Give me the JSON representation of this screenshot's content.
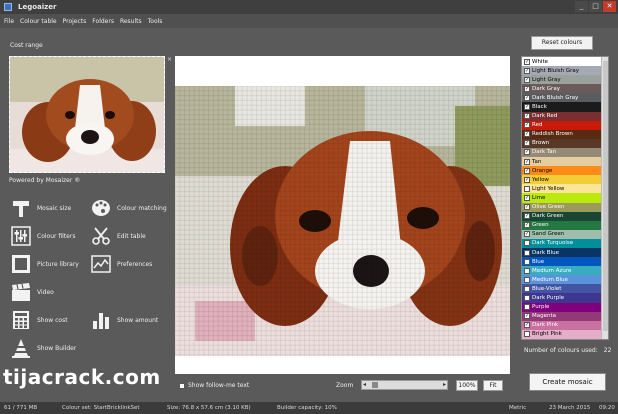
{
  "window": {
    "title": "Legoaizer",
    "controls": [
      "_",
      "□",
      "✕"
    ]
  },
  "menu": [
    "File",
    "Colour table",
    "Projects",
    "Folders",
    "Results",
    "Tools"
  ],
  "left_panel": {
    "cost_range": "Cost range",
    "close_glyph": "×",
    "powered_by": "Powered by Mosaizer ®",
    "tools": [
      {
        "label": "Mosaic size",
        "icon": "hammer-icon"
      },
      {
        "label": "Colour matching",
        "icon": "palette-icon"
      },
      {
        "label": "Colour filters",
        "icon": "sliders-icon"
      },
      {
        "label": "Edit table",
        "icon": "scissors-icon"
      },
      {
        "label": "Picture library",
        "icon": "film-frame-icon"
      },
      {
        "label": "Preferences",
        "icon": "chart-window-icon"
      },
      {
        "label": "Video",
        "icon": "clapperboard-icon"
      },
      {
        "label": "Show cost",
        "icon": "calculator-icon"
      },
      {
        "label": "Show amount",
        "icon": "bar-chart-icon"
      },
      {
        "label": "Show Builder",
        "icon": "cone-icon"
      }
    ]
  },
  "right_panel": {
    "reset_button": "Reset colours",
    "colours": [
      {
        "name": "White",
        "hex": "#ffffff",
        "checked": true,
        "text": "#000000"
      },
      {
        "name": "Light Bluish Gray",
        "hex": "#a5a9b4",
        "checked": true,
        "text": "#000000"
      },
      {
        "name": "Light Gray",
        "hex": "#9ba19d",
        "checked": true,
        "text": "#000000"
      },
      {
        "name": "Dark Gray",
        "hex": "#6b5a5a",
        "checked": true,
        "text": "#ffffff"
      },
      {
        "name": "Dark Bluish Gray",
        "hex": "#595d60",
        "checked": true,
        "text": "#ffffff"
      },
      {
        "name": "Black",
        "hex": "#1b1b1b",
        "checked": true,
        "text": "#ffffff"
      },
      {
        "name": "Dark Red",
        "hex": "#7b2e2f",
        "checked": true,
        "text": "#ffffff"
      },
      {
        "name": "Red",
        "hex": "#c91a09",
        "checked": true,
        "text": "#ffffff"
      },
      {
        "name": "Reddish Brown",
        "hex": "#582a12",
        "checked": true,
        "text": "#ffffff"
      },
      {
        "name": "Brown",
        "hex": "#583927",
        "checked": true,
        "text": "#ffffff"
      },
      {
        "name": "Dark Tan",
        "hex": "#958a73",
        "checked": true,
        "text": "#ffffff"
      },
      {
        "name": "Tan",
        "hex": "#e4cd9e",
        "checked": true,
        "text": "#000000"
      },
      {
        "name": "Orange",
        "hex": "#fe8a18",
        "checked": true,
        "text": "#000000"
      },
      {
        "name": "Yellow",
        "hex": "#f2cd37",
        "checked": true,
        "text": "#000000"
      },
      {
        "name": "Light Yellow",
        "hex": "#fbe696",
        "checked": false,
        "text": "#000000"
      },
      {
        "name": "Lime",
        "hex": "#bbe90b",
        "checked": true,
        "text": "#000000"
      },
      {
        "name": "Olive Green",
        "hex": "#9b9a5a",
        "checked": true,
        "text": "#ffffff"
      },
      {
        "name": "Dark Green",
        "hex": "#184632",
        "checked": true,
        "text": "#ffffff"
      },
      {
        "name": "Green",
        "hex": "#237841",
        "checked": true,
        "text": "#ffffff"
      },
      {
        "name": "Sand Green",
        "hex": "#a0bcac",
        "checked": true,
        "text": "#000000"
      },
      {
        "name": "Dark Turquoise",
        "hex": "#008f9b",
        "checked": false,
        "text": "#ffffff"
      },
      {
        "name": "Dark Blue",
        "hex": "#0a3463",
        "checked": false,
        "text": "#ffffff"
      },
      {
        "name": "Blue",
        "hex": "#0055bf",
        "checked": false,
        "text": "#ffffff"
      },
      {
        "name": "Medium Azure",
        "hex": "#36aebf",
        "checked": false,
        "text": "#ffffff"
      },
      {
        "name": "Medium Blue",
        "hex": "#5a93db",
        "checked": false,
        "text": "#ffffff"
      },
      {
        "name": "Blue-Violet",
        "hex": "#4354a3",
        "checked": false,
        "text": "#ffffff"
      },
      {
        "name": "Dark Purple",
        "hex": "#3f3691",
        "checked": false,
        "text": "#ffffff"
      },
      {
        "name": "Purple",
        "hex": "#81007b",
        "checked": false,
        "text": "#ffffff"
      },
      {
        "name": "Magenta",
        "hex": "#923978",
        "checked": true,
        "text": "#ffffff"
      },
      {
        "name": "Dark Pink",
        "hex": "#c870a0",
        "checked": true,
        "text": "#ffffff"
      },
      {
        "name": "Bright Pink",
        "hex": "#e4adc8",
        "checked": false,
        "text": "#000000"
      }
    ],
    "colours_used_label": "Number of colours used:",
    "colours_used_value": "22",
    "create_button": "Create mosaic"
  },
  "bottom_bar": {
    "follow_label": "Show follow-me text",
    "zoom_label": "Zoom",
    "zoom_level": 0.12,
    "zoom_left_arrow": "◂",
    "zoom_right_arrow": "▸",
    "zoom_percent": "100%",
    "fit_button": "Fit"
  },
  "watermark": "tijacrack.com",
  "status": {
    "memory": "61 / 771 MB",
    "colour_set": "Colour set: StartBricklinkSet",
    "size": "Size: 76.8 x 57.6 cm (3.10 KB)",
    "builder": "Builder capacity: 10%",
    "units": "Metric",
    "date": "23 March 2015",
    "time": "09:20"
  }
}
